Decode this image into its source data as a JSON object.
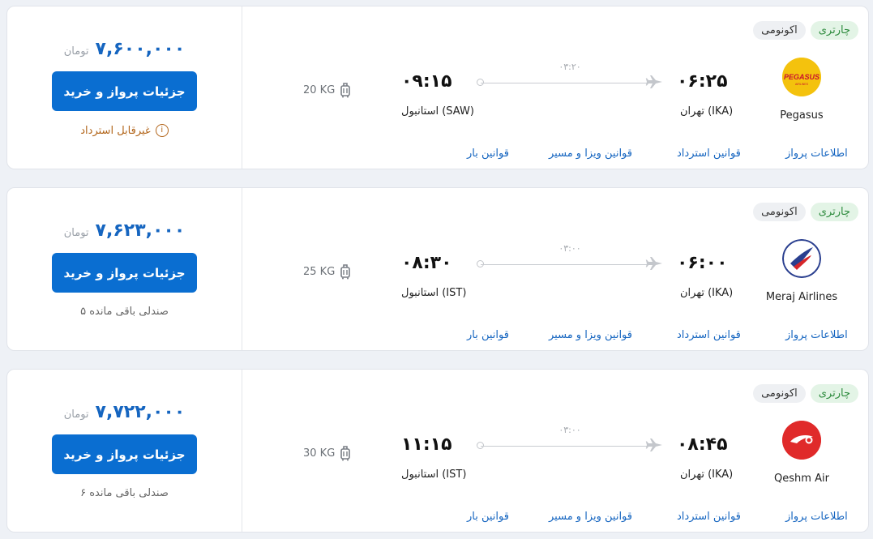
{
  "flights": [
    {
      "tag_charter": "چارتری",
      "tag_class": "اکونومی",
      "airline": "Pegasus",
      "logo_icon": "pegasus-logo-icon",
      "dep_time": "۰۶:۲۵",
      "arr_time": "۰۹:۱۵",
      "dep_city": "تهران (IKA)",
      "arr_city": "استانبول (SAW)",
      "duration": "۰۳:۲۰",
      "baggage": "20 KG",
      "currency": "تومان",
      "price": "۷,۶۰۰,۰۰۰",
      "buy_label": "جزئیات پرواز و خرید",
      "note": "غیرقابل استرداد",
      "links": [
        "اطلاعات پرواز",
        "قوانین استرداد",
        "قوانین ویزا و مسیر",
        "قوانین بار"
      ]
    },
    {
      "tag_charter": "چارتری",
      "tag_class": "اکونومی",
      "airline": "Meraj Airlines",
      "logo_icon": "meraj-logo-icon",
      "dep_time": "۰۶:۰۰",
      "arr_time": "۰۸:۳۰",
      "dep_city": "تهران (IKA)",
      "arr_city": "استانبول (IST)",
      "duration": "۰۳:۰۰",
      "baggage": "25 KG",
      "currency": "تومان",
      "price": "۷,۶۲۳,۰۰۰",
      "buy_label": "جزئیات پرواز و خرید",
      "note": "۵ صندلی باقی مانده",
      "links": [
        "اطلاعات پرواز",
        "قوانین استرداد",
        "قوانین ویزا و مسیر",
        "قوانین بار"
      ]
    },
    {
      "tag_charter": "چارتری",
      "tag_class": "اکونومی",
      "airline": "Qeshm Air",
      "logo_icon": "qeshm-logo-icon",
      "dep_time": "۰۸:۴۵",
      "arr_time": "۱۱:۱۵",
      "dep_city": "تهران (IKA)",
      "arr_city": "استانبول (IST)",
      "duration": "۰۳:۰۰",
      "baggage": "30 KG",
      "currency": "تومان",
      "price": "۷,۷۲۲,۰۰۰",
      "buy_label": "جزئیات پرواز و خرید",
      "note": "۶ صندلی باقی مانده",
      "links": [
        "اطلاعات پرواز",
        "قوانین استرداد",
        "قوانین ویزا و مسیر",
        "قوانین بار"
      ]
    }
  ],
  "colors": {
    "primary": "#0a6ed1",
    "price": "#1565c0",
    "charter_bg": "#e3f4e6",
    "charter_text": "#2e8b3e",
    "refund_note": "#b2651a"
  }
}
